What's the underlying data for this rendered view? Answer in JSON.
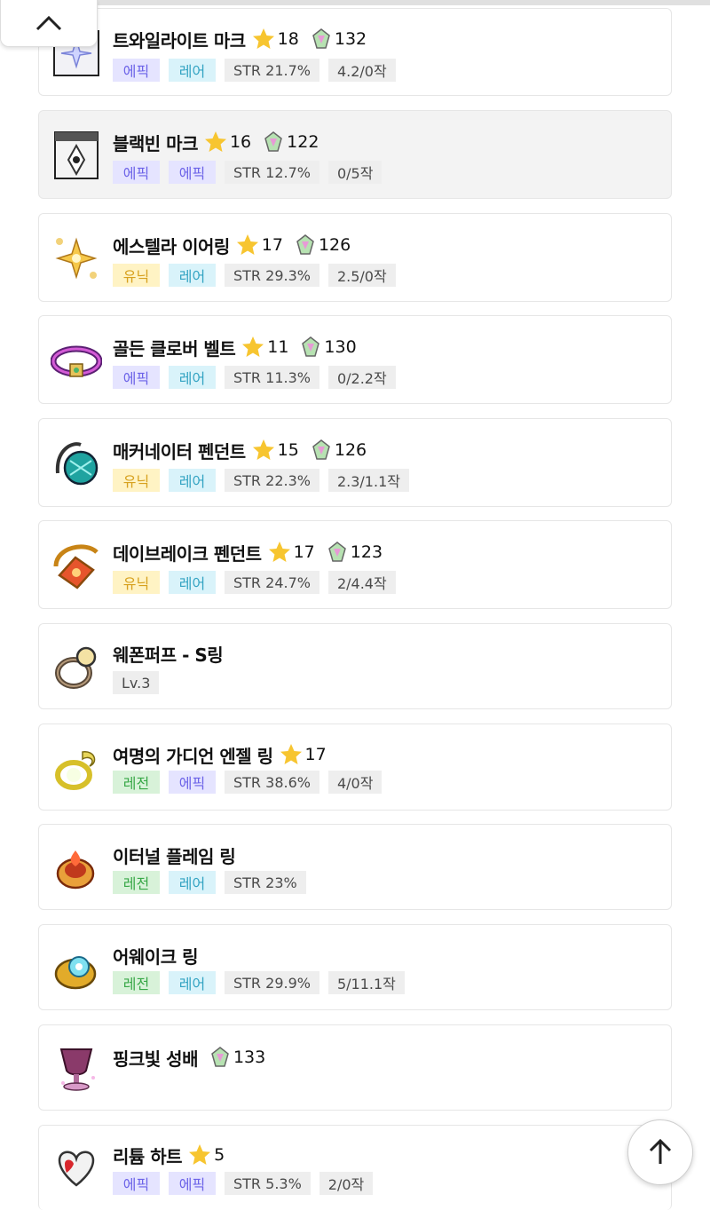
{
  "items": [
    {
      "name": "트와일라이트 마크",
      "star": "18",
      "gem": "132",
      "tags": [
        "에픽",
        "레어",
        "STR 21.7%",
        "4.2/0작"
      ],
      "icon": "twilight-mark-icon"
    },
    {
      "name": "블랙빈 마크",
      "star": "16",
      "gem": "122",
      "tags": [
        "에픽",
        "에픽",
        "STR 12.7%",
        "0/5작"
      ],
      "icon": "blackbean-mark-icon"
    },
    {
      "name": "에스텔라 이어링",
      "star": "17",
      "gem": "126",
      "tags": [
        "유닉",
        "레어",
        "STR 29.3%",
        "2.5/0작"
      ],
      "icon": "estella-earring-icon"
    },
    {
      "name": "골든 클로버 벨트",
      "star": "11",
      "gem": "130",
      "tags": [
        "에픽",
        "레어",
        "STR 11.3%",
        "0/2.2작"
      ],
      "icon": "golden-clover-belt-icon"
    },
    {
      "name": "매커네이터 펜던트",
      "star": "15",
      "gem": "126",
      "tags": [
        "유닉",
        "레어",
        "STR 22.3%",
        "2.3/1.1작"
      ],
      "icon": "mechanator-pendant-icon"
    },
    {
      "name": "데이브레이크 펜던트",
      "star": "17",
      "gem": "123",
      "tags": [
        "유닉",
        "레어",
        "STR 24.7%",
        "2/4.4작"
      ],
      "icon": "daybreak-pendant-icon"
    },
    {
      "name": "웨폰퍼프 - S링",
      "tags": [
        "Lv.3"
      ],
      "icon": "weapon-puff-ring-icon"
    },
    {
      "name": "여명의 가디언 엔젤 링",
      "star": "17",
      "tags": [
        "레전",
        "에픽",
        "STR 38.6%",
        "4/0작"
      ],
      "icon": "guardian-angel-ring-icon"
    },
    {
      "name": "이터널 플레임 링",
      "tags": [
        "레전",
        "레어",
        "STR 23%"
      ],
      "icon": "eternal-flame-ring-icon"
    },
    {
      "name": "어웨이크 링",
      "tags": [
        "레전",
        "레어",
        "STR 29.9%",
        "5/11.1작"
      ],
      "icon": "awake-ring-icon"
    },
    {
      "name": "핑크빛 성배",
      "gem": "133",
      "tags": [],
      "icon": "pink-holy-cup-icon"
    },
    {
      "name": "리튬 하트",
      "star": "5",
      "tags": [
        "에픽",
        "에픽",
        "STR 5.3%",
        "2/0작"
      ],
      "icon": "lithium-heart-icon"
    }
  ],
  "colors": {
    "epic": "#6c63e8",
    "rare": "#32a3c2",
    "unique": "#d7a11f",
    "legend": "#38a847",
    "star": "#f7c530"
  },
  "controls": {
    "collapse_icon": "chevron-up-icon",
    "top_icon": "arrow-up-icon"
  }
}
